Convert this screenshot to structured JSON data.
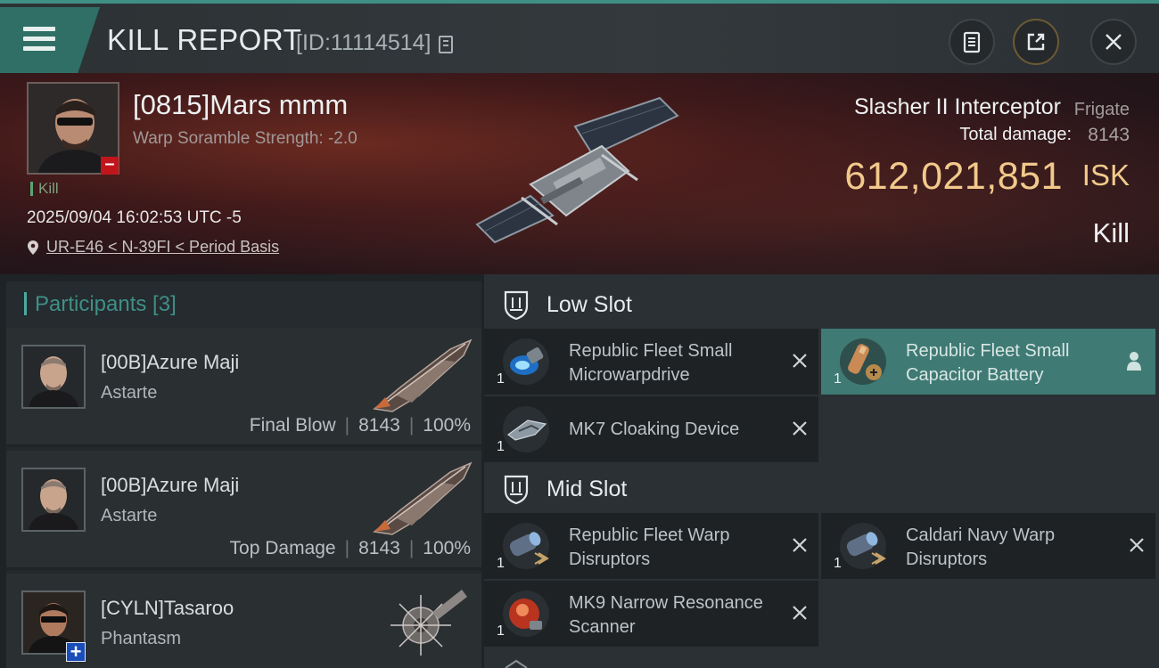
{
  "header": {
    "title": "KILL REPORT",
    "report_id": "[ID:11114514]",
    "icons": [
      "menu-icon",
      "copy-icon",
      "clipboard-icon",
      "share-icon",
      "close-icon"
    ]
  },
  "victim": {
    "name": "[0815]Mars mmm",
    "scramble": "Warp Soramble Strength: -2.0",
    "kill_label": "Kill",
    "timestamp": "2025/09/04 16:02:53 UTC -5",
    "location": "UR-E46 < N-39FI < Period Basis",
    "ship_name": "Slasher II Interceptor",
    "ship_class": "Frigate",
    "total_damage_label": "Total damage:",
    "total_damage": "8143",
    "isk_value": "612,021,851",
    "isk_unit": "ISK",
    "result": "Kill"
  },
  "participants": {
    "title": "Participants [3]",
    "items": [
      {
        "name": "[00B]Azure Maji",
        "ship": "Astarte",
        "role": "Final Blow",
        "damage": "8143",
        "percent": "100%"
      },
      {
        "name": "[00B]Azure Maji",
        "ship": "Astarte",
        "role": "Top Damage",
        "damage": "8143",
        "percent": "100%"
      },
      {
        "name": "[CYLN]Tasaroo",
        "ship": "Phantasm"
      }
    ]
  },
  "slots": {
    "low": {
      "title": "Low Slot",
      "modules": [
        {
          "name": "Republic Fleet Small Microwarpdrive",
          "qty": "1"
        },
        {
          "name": "Republic Fleet Small Capacitor Battery",
          "qty": "1",
          "highlighted": true
        },
        {
          "name": "MK7 Cloaking Device",
          "qty": "1"
        }
      ]
    },
    "mid": {
      "title": "Mid Slot",
      "modules": [
        {
          "name": "Republic Fleet Warp Disruptors",
          "qty": "1"
        },
        {
          "name": "Caldari Navy Warp Disruptors",
          "qty": "1"
        },
        {
          "name": "MK9 Narrow Resonance Scanner",
          "qty": "1"
        }
      ]
    }
  },
  "colors": {
    "accent_teal": "#3f8f85",
    "isk_gold": "#f2c98b",
    "highlight": "#3f7a74",
    "minus_red": "#c2151b",
    "plus_blue": "#1b4db8"
  }
}
